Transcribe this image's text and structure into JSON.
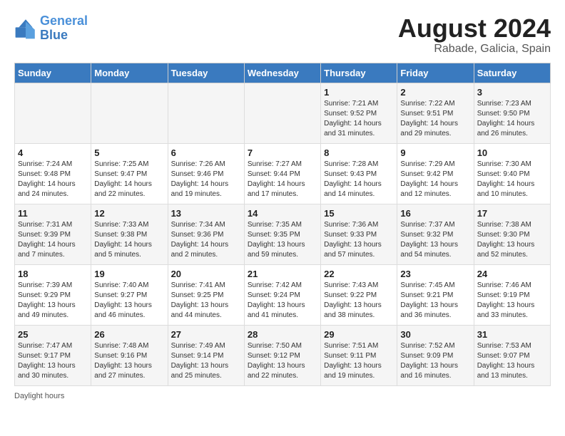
{
  "header": {
    "logo_line1": "General",
    "logo_line2": "Blue",
    "month_year": "August 2024",
    "location": "Rabade, Galicia, Spain"
  },
  "days_of_week": [
    "Sunday",
    "Monday",
    "Tuesday",
    "Wednesday",
    "Thursday",
    "Friday",
    "Saturday"
  ],
  "weeks": [
    [
      {
        "num": "",
        "sunrise": "",
        "sunset": "",
        "daylight": ""
      },
      {
        "num": "",
        "sunrise": "",
        "sunset": "",
        "daylight": ""
      },
      {
        "num": "",
        "sunrise": "",
        "sunset": "",
        "daylight": ""
      },
      {
        "num": "",
        "sunrise": "",
        "sunset": "",
        "daylight": ""
      },
      {
        "num": "1",
        "sunrise": "Sunrise: 7:21 AM",
        "sunset": "Sunset: 9:52 PM",
        "daylight": "Daylight: 14 hours and 31 minutes."
      },
      {
        "num": "2",
        "sunrise": "Sunrise: 7:22 AM",
        "sunset": "Sunset: 9:51 PM",
        "daylight": "Daylight: 14 hours and 29 minutes."
      },
      {
        "num": "3",
        "sunrise": "Sunrise: 7:23 AM",
        "sunset": "Sunset: 9:50 PM",
        "daylight": "Daylight: 14 hours and 26 minutes."
      }
    ],
    [
      {
        "num": "4",
        "sunrise": "Sunrise: 7:24 AM",
        "sunset": "Sunset: 9:48 PM",
        "daylight": "Daylight: 14 hours and 24 minutes."
      },
      {
        "num": "5",
        "sunrise": "Sunrise: 7:25 AM",
        "sunset": "Sunset: 9:47 PM",
        "daylight": "Daylight: 14 hours and 22 minutes."
      },
      {
        "num": "6",
        "sunrise": "Sunrise: 7:26 AM",
        "sunset": "Sunset: 9:46 PM",
        "daylight": "Daylight: 14 hours and 19 minutes."
      },
      {
        "num": "7",
        "sunrise": "Sunrise: 7:27 AM",
        "sunset": "Sunset: 9:44 PM",
        "daylight": "Daylight: 14 hours and 17 minutes."
      },
      {
        "num": "8",
        "sunrise": "Sunrise: 7:28 AM",
        "sunset": "Sunset: 9:43 PM",
        "daylight": "Daylight: 14 hours and 14 minutes."
      },
      {
        "num": "9",
        "sunrise": "Sunrise: 7:29 AM",
        "sunset": "Sunset: 9:42 PM",
        "daylight": "Daylight: 14 hours and 12 minutes."
      },
      {
        "num": "10",
        "sunrise": "Sunrise: 7:30 AM",
        "sunset": "Sunset: 9:40 PM",
        "daylight": "Daylight: 14 hours and 10 minutes."
      }
    ],
    [
      {
        "num": "11",
        "sunrise": "Sunrise: 7:31 AM",
        "sunset": "Sunset: 9:39 PM",
        "daylight": "Daylight: 14 hours and 7 minutes."
      },
      {
        "num": "12",
        "sunrise": "Sunrise: 7:33 AM",
        "sunset": "Sunset: 9:38 PM",
        "daylight": "Daylight: 14 hours and 5 minutes."
      },
      {
        "num": "13",
        "sunrise": "Sunrise: 7:34 AM",
        "sunset": "Sunset: 9:36 PM",
        "daylight": "Daylight: 14 hours and 2 minutes."
      },
      {
        "num": "14",
        "sunrise": "Sunrise: 7:35 AM",
        "sunset": "Sunset: 9:35 PM",
        "daylight": "Daylight: 13 hours and 59 minutes."
      },
      {
        "num": "15",
        "sunrise": "Sunrise: 7:36 AM",
        "sunset": "Sunset: 9:33 PM",
        "daylight": "Daylight: 13 hours and 57 minutes."
      },
      {
        "num": "16",
        "sunrise": "Sunrise: 7:37 AM",
        "sunset": "Sunset: 9:32 PM",
        "daylight": "Daylight: 13 hours and 54 minutes."
      },
      {
        "num": "17",
        "sunrise": "Sunrise: 7:38 AM",
        "sunset": "Sunset: 9:30 PM",
        "daylight": "Daylight: 13 hours and 52 minutes."
      }
    ],
    [
      {
        "num": "18",
        "sunrise": "Sunrise: 7:39 AM",
        "sunset": "Sunset: 9:29 PM",
        "daylight": "Daylight: 13 hours and 49 minutes."
      },
      {
        "num": "19",
        "sunrise": "Sunrise: 7:40 AM",
        "sunset": "Sunset: 9:27 PM",
        "daylight": "Daylight: 13 hours and 46 minutes."
      },
      {
        "num": "20",
        "sunrise": "Sunrise: 7:41 AM",
        "sunset": "Sunset: 9:25 PM",
        "daylight": "Daylight: 13 hours and 44 minutes."
      },
      {
        "num": "21",
        "sunrise": "Sunrise: 7:42 AM",
        "sunset": "Sunset: 9:24 PM",
        "daylight": "Daylight: 13 hours and 41 minutes."
      },
      {
        "num": "22",
        "sunrise": "Sunrise: 7:43 AM",
        "sunset": "Sunset: 9:22 PM",
        "daylight": "Daylight: 13 hours and 38 minutes."
      },
      {
        "num": "23",
        "sunrise": "Sunrise: 7:45 AM",
        "sunset": "Sunset: 9:21 PM",
        "daylight": "Daylight: 13 hours and 36 minutes."
      },
      {
        "num": "24",
        "sunrise": "Sunrise: 7:46 AM",
        "sunset": "Sunset: 9:19 PM",
        "daylight": "Daylight: 13 hours and 33 minutes."
      }
    ],
    [
      {
        "num": "25",
        "sunrise": "Sunrise: 7:47 AM",
        "sunset": "Sunset: 9:17 PM",
        "daylight": "Daylight: 13 hours and 30 minutes."
      },
      {
        "num": "26",
        "sunrise": "Sunrise: 7:48 AM",
        "sunset": "Sunset: 9:16 PM",
        "daylight": "Daylight: 13 hours and 27 minutes."
      },
      {
        "num": "27",
        "sunrise": "Sunrise: 7:49 AM",
        "sunset": "Sunset: 9:14 PM",
        "daylight": "Daylight: 13 hours and 25 minutes."
      },
      {
        "num": "28",
        "sunrise": "Sunrise: 7:50 AM",
        "sunset": "Sunset: 9:12 PM",
        "daylight": "Daylight: 13 hours and 22 minutes."
      },
      {
        "num": "29",
        "sunrise": "Sunrise: 7:51 AM",
        "sunset": "Sunset: 9:11 PM",
        "daylight": "Daylight: 13 hours and 19 minutes."
      },
      {
        "num": "30",
        "sunrise": "Sunrise: 7:52 AM",
        "sunset": "Sunset: 9:09 PM",
        "daylight": "Daylight: 13 hours and 16 minutes."
      },
      {
        "num": "31",
        "sunrise": "Sunrise: 7:53 AM",
        "sunset": "Sunset: 9:07 PM",
        "daylight": "Daylight: 13 hours and 13 minutes."
      }
    ]
  ],
  "footer": {
    "daylight_hours_label": "Daylight hours"
  }
}
